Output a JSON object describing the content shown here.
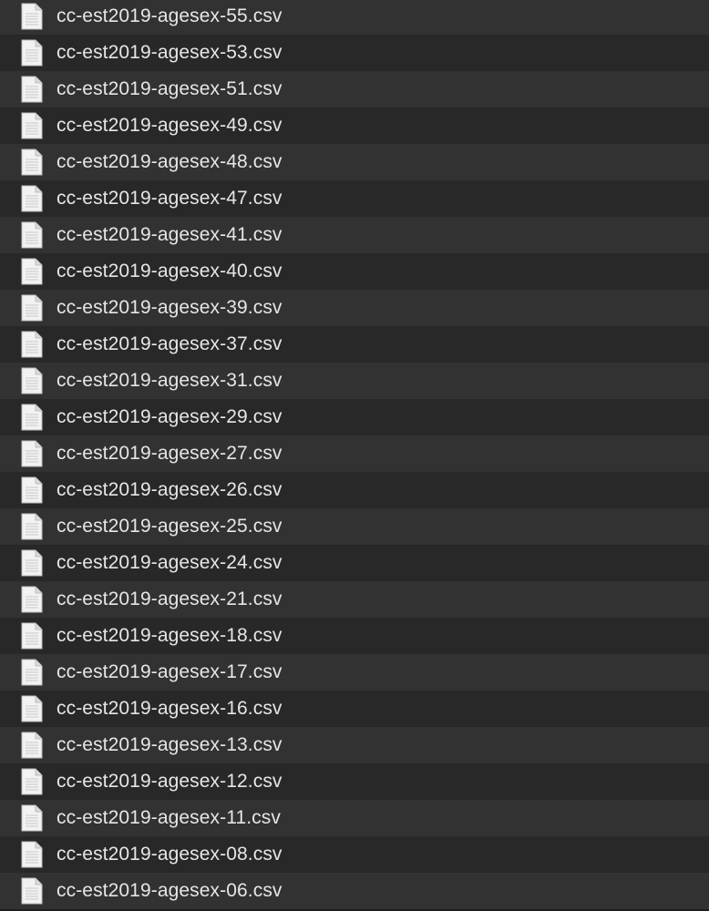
{
  "file_list": {
    "icon": "document-icon",
    "files": [
      "cc-est2019-agesex-55.csv",
      "cc-est2019-agesex-53.csv",
      "cc-est2019-agesex-51.csv",
      "cc-est2019-agesex-49.csv",
      "cc-est2019-agesex-48.csv",
      "cc-est2019-agesex-47.csv",
      "cc-est2019-agesex-41.csv",
      "cc-est2019-agesex-40.csv",
      "cc-est2019-agesex-39.csv",
      "cc-est2019-agesex-37.csv",
      "cc-est2019-agesex-31.csv",
      "cc-est2019-agesex-29.csv",
      "cc-est2019-agesex-27.csv",
      "cc-est2019-agesex-26.csv",
      "cc-est2019-agesex-25.csv",
      "cc-est2019-agesex-24.csv",
      "cc-est2019-agesex-21.csv",
      "cc-est2019-agesex-18.csv",
      "cc-est2019-agesex-17.csv",
      "cc-est2019-agesex-16.csv",
      "cc-est2019-agesex-13.csv",
      "cc-est2019-agesex-12.csv",
      "cc-est2019-agesex-11.csv",
      "cc-est2019-agesex-08.csv",
      "cc-est2019-agesex-06.csv"
    ]
  }
}
